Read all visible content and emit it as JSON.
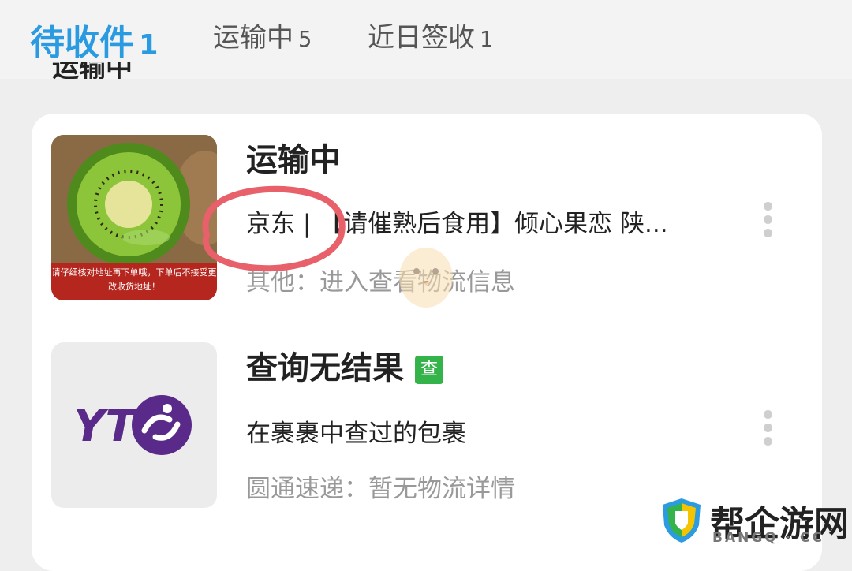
{
  "tabs": [
    {
      "label": "待收件",
      "count": "1",
      "active": true
    },
    {
      "label": "运输中",
      "count": "5",
      "active": false
    },
    {
      "label": "近日签收",
      "count": "1",
      "active": false
    }
  ],
  "section_heading": "运输中",
  "packages": [
    {
      "status": "运输中",
      "title": "京东 | 【请催熟后食用】倾心果恋 陕...",
      "detail": "其他：进入查看物流信息",
      "thumbnail_caption": "请仔细核对地址再下单哦，下单后不接受更改收货地址！"
    },
    {
      "status": "查询无结果",
      "badge": "查",
      "title": "在裹裹中查过的包裹",
      "detail": "圆通速递：暂无物流详情",
      "logo_text": "YT"
    }
  ],
  "watermark": {
    "title": "帮企游网",
    "subtitle": "BANGQ · CC"
  },
  "colors": {
    "accent": "#2a9be0",
    "badge": "#34b34a",
    "annotation": "#e8606a"
  },
  "icons": [
    "kiwi-thumbnail",
    "yto-logo",
    "more-vertical-icon",
    "chick-sticker",
    "shield-logo-icon"
  ]
}
